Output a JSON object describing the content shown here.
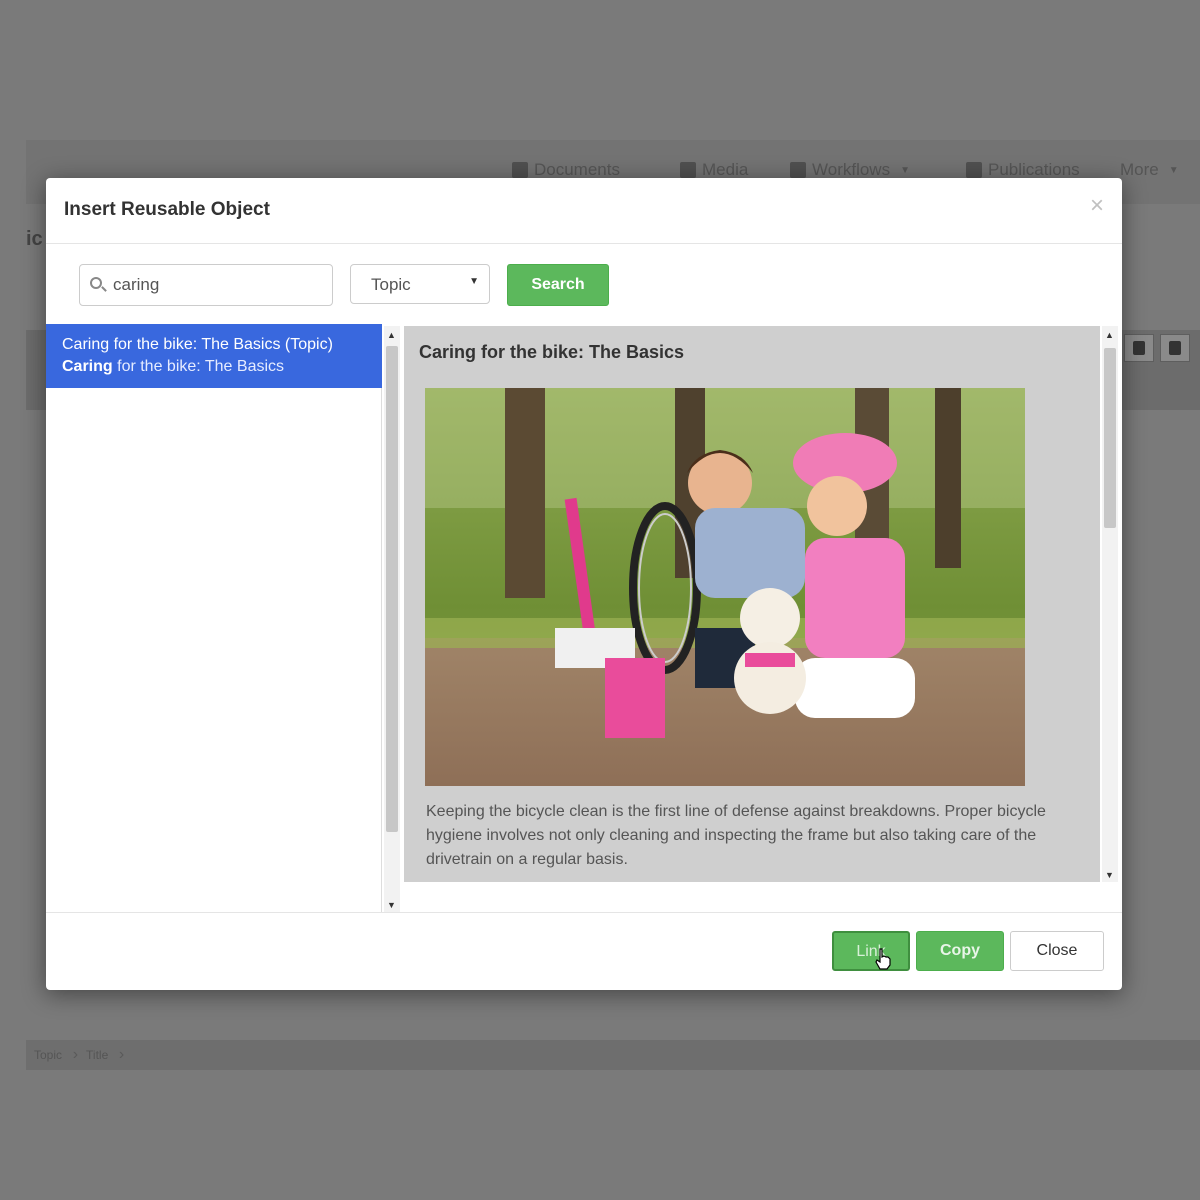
{
  "background": {
    "nav": [
      {
        "label": "Documents",
        "icon": "home-icon"
      },
      {
        "label": "Media",
        "icon": "music-icon"
      },
      {
        "label": "Workflows",
        "icon": "gears-icon"
      },
      {
        "label": "Publications",
        "icon": "book-icon"
      },
      {
        "label": "More",
        "icon": "caret-down-icon"
      }
    ],
    "left_fragment": "ic",
    "breadcrumb": [
      "Topic",
      "Title"
    ]
  },
  "modal": {
    "title": "Insert Reusable Object",
    "close_symbol": "×",
    "search": {
      "value": "caring",
      "placeholder": ""
    },
    "type_select": {
      "selected": "Topic"
    },
    "search_button": "Search",
    "results": [
      {
        "title": "Caring for the bike: The Basics (Topic)",
        "snippet_match": "Caring",
        "snippet_rest": " for the bike: The Basics"
      }
    ],
    "preview": {
      "title": "Caring for the bike: The Basics",
      "body": "Keeping the bicycle clean is the first line of defense against breakdowns. Proper bicycle hygiene involves not only cleaning and inspecting the frame but also taking care of the drivetrain on a regular basis.",
      "image_description_icon": "photo-children-bicycle"
    },
    "footer": {
      "link": "Link",
      "copy": "Copy",
      "close": "Close"
    }
  },
  "colors": {
    "accent": "#3968de",
    "success": "#5cb85c"
  }
}
